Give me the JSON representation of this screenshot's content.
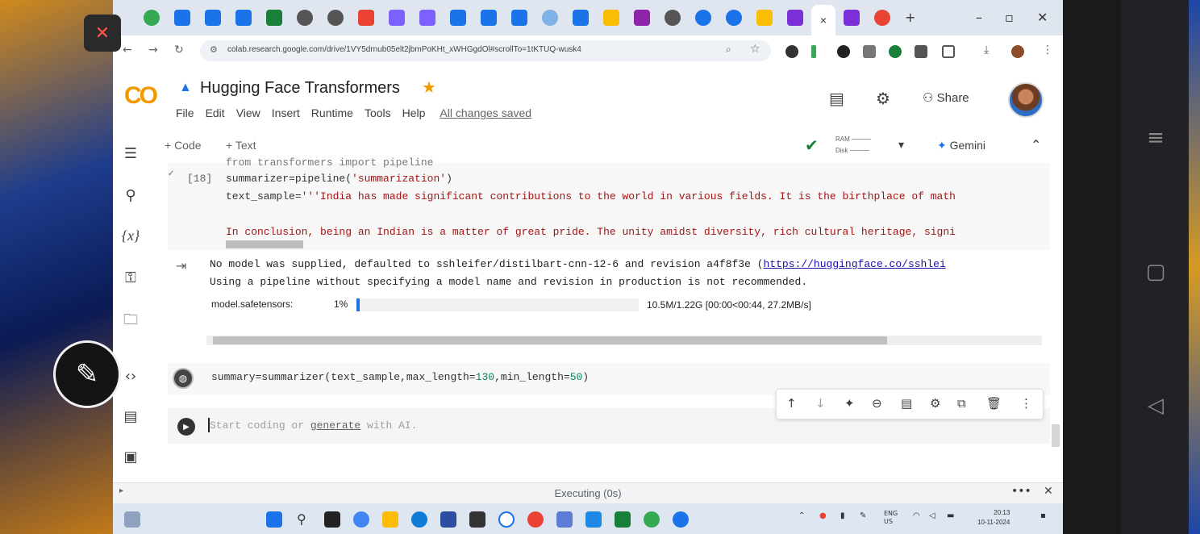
{
  "browser": {
    "url": "colab.research.google.com/drive/1VY5drnub05elt2jbmPoKHt_xWHGgdOl#scrollTo=1tKTUQ-wusk4",
    "new_tab": "+",
    "active_tab_close": "×",
    "window_min": "–",
    "window_max": "▫",
    "window_close": "✕"
  },
  "colab": {
    "logo": "CO",
    "title": "Hugging Face Transformers",
    "menu": [
      "File",
      "Edit",
      "View",
      "Insert",
      "Runtime",
      "Tools",
      "Help"
    ],
    "save_status": "All changes saved",
    "share_label": "Share"
  },
  "toolbar": {
    "add_code": "+ Code",
    "add_text": "+ Text",
    "ram_label": "RAM",
    "disk_label": "Disk",
    "gemini_label": "Gemini"
  },
  "cell1": {
    "exec_count": "[18]",
    "line0": "from transformers import pipeline",
    "line1_var": "summarizer=pipeline(",
    "line1_str": "'summarization'",
    "line1_end": ")",
    "line2_var": "text_sample=",
    "line2_str": "'''India has made significant contributions to the world in various fields. It is the birthplace of math",
    "line3_str": "In conclusion, being an Indian is a matter of great pride. The unity amidst diversity, rich cultural heritage, signi"
  },
  "output": {
    "line1_text": "No model was supplied, defaulted to sshleifer/distilbart-cnn-12-6 and revision a4f8f3e (",
    "line1_link": "https://huggingface.co/sshlei",
    "line2_text": "Using a pipeline without specifying a model name and revision in production is not recommended.",
    "progress_label": "model.safetensors:",
    "progress_pct": "1%",
    "progress_fraction": 0.01,
    "progress_stats": "10.5M/1.22G [00:00<00:44, 27.2MB/s]"
  },
  "cell2": {
    "code_a": "summary=summarizer(text_sample,max_length=",
    "num_a": "130",
    "code_b": ",min_length=",
    "num_b": "50",
    "code_c": ")"
  },
  "cell3": {
    "placeholder_a": "Start coding or ",
    "placeholder_link": "generate",
    "placeholder_b": " with AI."
  },
  "status": {
    "text": "Executing (0s)",
    "more": "•••",
    "close": "✕"
  },
  "taskbar": {
    "lang": "ENG",
    "region": "US",
    "time": "20:13",
    "date": "10-11-2024"
  },
  "colors": {
    "colab_orange": "#f29900",
    "progress_blue": "#1a73e8",
    "string_red": "#a31515",
    "number_green": "#098658"
  },
  "icons": [
    "mic-off-icon",
    "pencil-icon",
    "search-icon",
    "gear-icon",
    "comment-icon",
    "people-icon",
    "code-icon",
    "key-icon",
    "folder-icon",
    "terminal-icon",
    "play-icon",
    "check-icon",
    "star-icon"
  ]
}
